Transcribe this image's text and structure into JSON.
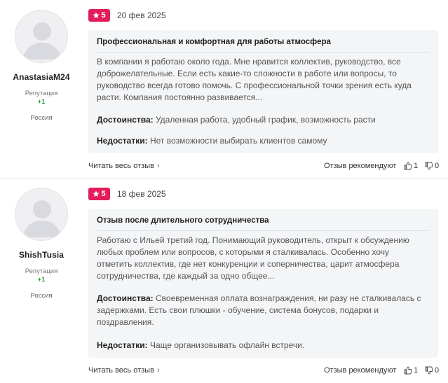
{
  "colors": {
    "accent": "#e31d5c",
    "reputation_positive": "#2e9e3e"
  },
  "reviews": [
    {
      "username": "AnastasiaM24",
      "reputation_label": "Репутация",
      "reputation_value": "+1",
      "country": "Россия",
      "rating": "5",
      "date": "20 фев 2025",
      "title": "Профессиональная и комфортная для работы атмосфера",
      "body": "В компании я работаю около года. Мне нравится коллектив, руководство, все доброжелательные. Если есть какие-то сложности в работе или вопросы, то руководство всегда готово помочь. С профессиональной точки зрения есть куда расти. Компания постоянно развивается...",
      "pros_label": "Достоинства:",
      "pros_text": "Удаленная работа, удобный график, возможность расти",
      "cons_label": "Недостатки:",
      "cons_text": "Нет возможности выбирать клиентов самому",
      "read_full": "Читать весь отзыв",
      "recommend_label": "Отзыв рекомендуют",
      "likes": "1",
      "dislikes": "0"
    },
    {
      "username": "ShishTusia",
      "reputation_label": "Репутация",
      "reputation_value": "+1",
      "country": "Россия",
      "rating": "5",
      "date": "18 фев 2025",
      "title": "Отзыв после длительного сотрудничества",
      "body": "Работаю с Ильей третий год. Понимающий руководитель, открыт к обсуждению любых проблем или вопросов, с которыми я сталкивалась. Особенно хочу отметить коллектив, где нет конкуренции и соперничества, царит атмосфера сотрудничества, где каждый за одно общее...",
      "pros_label": "Достоинства:",
      "pros_text": "Своевременная оплата вознаграждения, ни разу не сталкивалась с задержками. Есть свои плюшки - обучение, система бонусов, подарки и поздравления.",
      "cons_label": "Недостатки:",
      "cons_text": "Чаще организовывать офлайн встречи.",
      "read_full": "Читать весь отзыв",
      "recommend_label": "Отзыв рекомендуют",
      "likes": "1",
      "dislikes": "0"
    }
  ],
  "icons": {
    "rating": "star-icon",
    "read_more": "chevron-right-icon",
    "like": "thumbs-up-icon",
    "dislike": "thumbs-down-icon",
    "avatar": "user-placeholder-icon"
  }
}
